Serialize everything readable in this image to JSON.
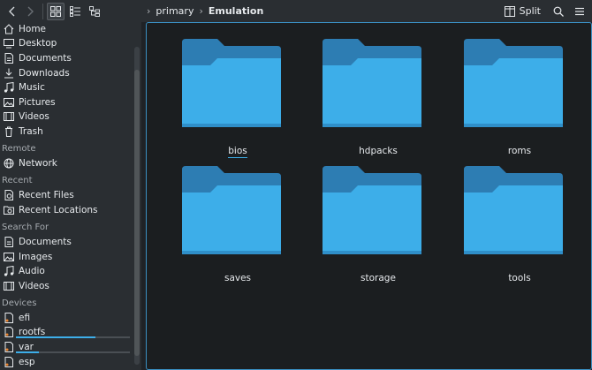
{
  "toolbar": {
    "breadcrumbs": [
      "primary",
      "Emulation"
    ],
    "split_label": "Split",
    "back_icon": "chevron-left-icon",
    "forward_icon": "chevron-right-icon",
    "view_icons": [
      "icons-view-icon",
      "details-view-icon",
      "tree-view-icon"
    ],
    "search_icon": "search-icon",
    "menu_icon": "hamburger-menu-icon",
    "split_icon": "split-view-icon"
  },
  "sidebar": {
    "places": [
      {
        "label": "Home",
        "icon": "home-icon"
      },
      {
        "label": "Desktop",
        "icon": "desktop-icon"
      },
      {
        "label": "Documents",
        "icon": "document-icon"
      },
      {
        "label": "Downloads",
        "icon": "download-icon"
      },
      {
        "label": "Music",
        "icon": "music-icon"
      },
      {
        "label": "Pictures",
        "icon": "picture-icon"
      },
      {
        "label": "Videos",
        "icon": "video-icon"
      },
      {
        "label": "Trash",
        "icon": "trash-icon"
      }
    ],
    "remote_header": "Remote",
    "remote": [
      {
        "label": "Network",
        "icon": "network-icon"
      }
    ],
    "recent_header": "Recent",
    "recent": [
      {
        "label": "Recent Files",
        "icon": "recent-files-icon"
      },
      {
        "label": "Recent Locations",
        "icon": "recent-locations-icon"
      }
    ],
    "search_header": "Search For",
    "search": [
      {
        "label": "Documents",
        "icon": "document-icon"
      },
      {
        "label": "Images",
        "icon": "image-icon"
      },
      {
        "label": "Audio",
        "icon": "audio-icon"
      },
      {
        "label": "Videos",
        "icon": "video-icon"
      }
    ],
    "devices_header": "Devices",
    "devices": [
      {
        "label": "efi",
        "icon": "drive-icon",
        "usage": null
      },
      {
        "label": "rootfs",
        "icon": "drive-icon",
        "usage": 0.7
      },
      {
        "label": "var",
        "icon": "drive-icon",
        "usage": 0.2
      },
      {
        "label": "esp",
        "icon": "drive-icon",
        "usage": null
      }
    ]
  },
  "main": {
    "folders": [
      {
        "name": "bios",
        "icon": "folder-icon"
      },
      {
        "name": "hdpacks",
        "icon": "folder-icon"
      },
      {
        "name": "roms",
        "icon": "folder-icon"
      },
      {
        "name": "saves",
        "icon": "folder-icon"
      },
      {
        "name": "storage",
        "icon": "folder-icon"
      },
      {
        "name": "tools",
        "icon": "folder-icon"
      }
    ]
  },
  "colors": {
    "accent": "#3daee9",
    "folder_front": "#3daee9",
    "folder_back": "#2d7db3",
    "background": "#1b1e20",
    "sidebar": "#2a2e32"
  }
}
